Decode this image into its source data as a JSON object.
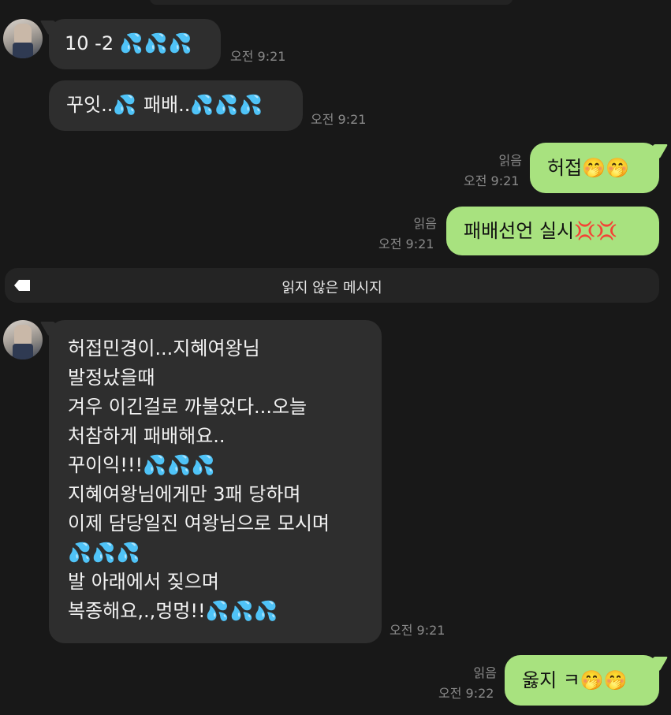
{
  "messages": [
    {
      "id": "m1",
      "side": "in",
      "text": "10 -2 ",
      "emoji": "💦💦💦",
      "time": "오전 9:21"
    },
    {
      "id": "m2",
      "side": "in",
      "text_a": "꾸잇..",
      "emoji_a": "💦",
      "text_b": " 패배..",
      "emoji_b": "💦💦💦",
      "time": "오전 9:21"
    },
    {
      "id": "m3",
      "side": "out",
      "read": "읽음",
      "text": "허접",
      "emoji": "🤭🤭",
      "time": "오전 9:21"
    },
    {
      "id": "m4",
      "side": "out",
      "read": "읽음",
      "text": "패배선언 실시",
      "emoji": "💢💢",
      "time": "오전 9:21"
    },
    {
      "id": "m5",
      "side": "in",
      "lines": [
        "허접민경이...지혜여왕님",
        "발정났을때",
        "겨우 이긴걸로 까불었다...오늘",
        "처참하게 패배해요..",
        "꾸이익!!!",
        "지혜여왕님에게만 3패 당하며",
        "이제 담당일진 여왕님으로 모시며",
        "",
        "발 아래에서 짖으며",
        "복종해요,.,멍멍!!"
      ],
      "line5_emoji": "💦💦💦",
      "line8_emoji": "💦💦💦",
      "line10_emoji": "💦💦💦",
      "time": "오전 9:21"
    },
    {
      "id": "m6",
      "side": "out",
      "read": "읽음",
      "text": "옳지 ㅋ",
      "emoji": "🤭🤭",
      "time": "오전 9:22"
    }
  ],
  "unread_divider": {
    "label": "읽지 않은 메시지",
    "icon": "tag-icon"
  },
  "colors": {
    "background": "#181818",
    "incoming": "#2e2e2e",
    "outgoing": "#a8e27f",
    "meta": "#8a8a8a",
    "drops": "#35a8ff"
  }
}
